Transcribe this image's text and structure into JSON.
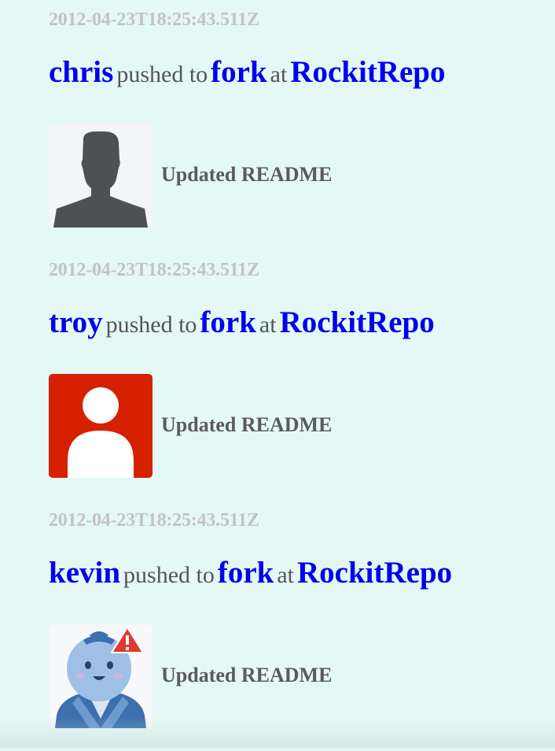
{
  "feed": {
    "events": [
      {
        "timestamp": "2012-04-23T18:25:43.511Z",
        "user": "chris",
        "action": "pushed to",
        "branch": "fork",
        "preposition": "at",
        "repo": "RockitRepo",
        "message": "Updated README",
        "avatar_icon": "silhouette-avatar-icon"
      },
      {
        "timestamp": "2012-04-23T18:25:43.511Z",
        "user": "troy",
        "action": "pushed to",
        "branch": "fork",
        "preposition": "at",
        "repo": "RockitRepo",
        "message": "Updated README",
        "avatar_icon": "default-user-avatar-icon"
      },
      {
        "timestamp": "2012-04-23T18:25:43.511Z",
        "user": "kevin",
        "action": "pushed to",
        "branch": "fork",
        "preposition": "at",
        "repo": "RockitRepo",
        "message": "Updated README",
        "avatar_icon": "cartoon-avatar-with-warning-icon"
      }
    ]
  },
  "colors": {
    "background": "#e4f8f6",
    "link": "#0000ee",
    "timestamp": "#c3c3c3",
    "text": "#555555",
    "troy_avatar_bg": "#d62000",
    "warning": "#e03a2f"
  }
}
